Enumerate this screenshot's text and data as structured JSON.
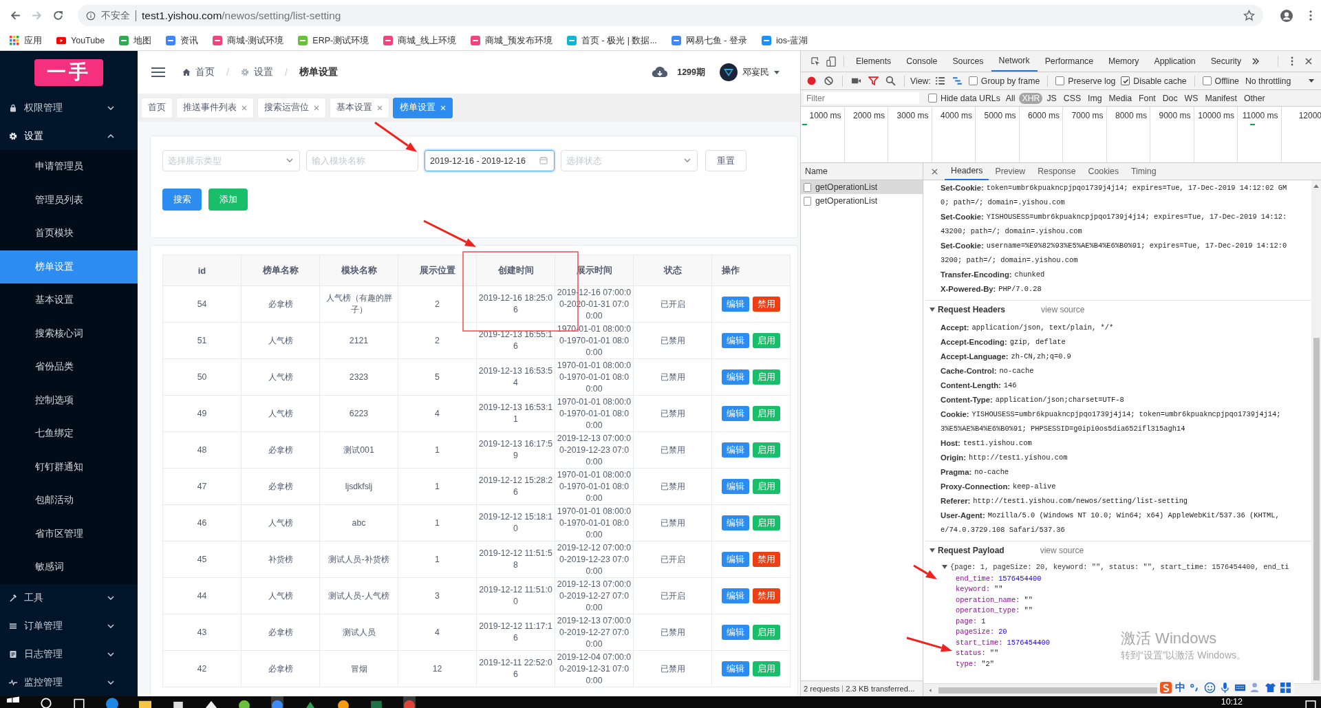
{
  "browser": {
    "security": "不安全",
    "url_host": "test1.yishou.com",
    "url_path": "/newos/setting/list-setting",
    "bookmarks": [
      {
        "label": "应用"
      },
      {
        "label": "YouTube"
      },
      {
        "label": "地图"
      },
      {
        "label": "资讯"
      },
      {
        "label": "商城-测试环境"
      },
      {
        "label": "ERP-测试环境"
      },
      {
        "label": "商城_线上环境"
      },
      {
        "label": "商城_预发布环境"
      },
      {
        "label": "首页 - 极光 | 数据..."
      },
      {
        "label": "网易七鱼 - 登录"
      },
      {
        "label": "ios-蓝湖"
      }
    ]
  },
  "sidebar": {
    "logo": "一手",
    "groups": [
      {
        "label": "权限管理",
        "expanded": false
      },
      {
        "label": "设置",
        "expanded": true,
        "children": [
          {
            "label": "申请管理员",
            "selected": false
          },
          {
            "label": "管理员列表",
            "selected": false
          },
          {
            "label": "首页模块",
            "selected": false
          },
          {
            "label": "榜单设置",
            "selected": true
          },
          {
            "label": "基本设置",
            "selected": false
          },
          {
            "label": "搜索核心词",
            "selected": false
          },
          {
            "label": "省份品类",
            "selected": false
          },
          {
            "label": "控制选项",
            "selected": false
          },
          {
            "label": "七鱼绑定",
            "selected": false
          },
          {
            "label": "钉钉群通知",
            "selected": false
          },
          {
            "label": "包邮活动",
            "selected": false
          },
          {
            "label": "省市区管理",
            "selected": false
          },
          {
            "label": "敏感词",
            "selected": false
          }
        ]
      },
      {
        "label": "工具",
        "expanded": false
      },
      {
        "label": "订单管理",
        "expanded": false
      },
      {
        "label": "日志管理",
        "expanded": false
      },
      {
        "label": "监控管理",
        "expanded": false
      }
    ]
  },
  "header": {
    "breadcrumb": [
      {
        "kind": "link",
        "label": "首页"
      },
      {
        "kind": "separator",
        "label": "/"
      },
      {
        "kind": "link",
        "label": "设置"
      },
      {
        "kind": "separator",
        "label": "/"
      },
      {
        "kind": "current",
        "label": "榜单设置"
      }
    ],
    "period": "1299期",
    "user": "邓宴民"
  },
  "tabs": [
    {
      "label": "首页",
      "closable": false,
      "selected": false
    },
    {
      "label": "推送事件列表",
      "closable": true,
      "selected": false
    },
    {
      "label": "搜索运营位",
      "closable": true,
      "selected": false
    },
    {
      "label": "基本设置",
      "closable": true,
      "selected": false
    },
    {
      "label": "榜单设置",
      "closable": true,
      "selected": true
    }
  ],
  "filters": {
    "type_placeholder": "选择展示类型",
    "name_placeholder": "输入模块名称",
    "date_value": "2019-12-16 - 2019-12-16",
    "date_focused": true,
    "status_placeholder": "选择状态",
    "reset": "重置",
    "search": "搜索",
    "add": "添加"
  },
  "table": {
    "columns": [
      "id",
      "榜单名称",
      "模块名称",
      "展示位置",
      "创建时间",
      "展示时间",
      "状态",
      "操作"
    ],
    "rows": [
      {
        "cells": [
          "54",
          "必拿榜",
          "人气榜（有趣的胖子）",
          "2",
          "2019-12-16 18:25:06",
          "2019-12-16 07:00:00-2020-01-31 07:00:00",
          "已开启"
        ],
        "actions": [
          {
            "label": "编辑",
            "kind": "edit"
          },
          {
            "label": "禁用",
            "kind": "disable"
          }
        ]
      },
      {
        "cells": [
          "51",
          "人气榜",
          "2121",
          "2",
          "2019-12-13 16:55:16",
          "1970-01-01 08:00:00-1970-01-01 08:00:00",
          "已禁用"
        ],
        "actions": [
          {
            "label": "编辑",
            "kind": "edit"
          },
          {
            "label": "启用",
            "kind": "enable"
          }
        ]
      },
      {
        "cells": [
          "50",
          "人气榜",
          "2323",
          "5",
          "2019-12-13 16:53:54",
          "1970-01-01 08:00:00-1970-01-01 08:00:00",
          "已禁用"
        ],
        "actions": [
          {
            "label": "编辑",
            "kind": "edit"
          },
          {
            "label": "启用",
            "kind": "enable"
          }
        ]
      },
      {
        "cells": [
          "49",
          "人气榜",
          "6223",
          "4",
          "2019-12-13 16:53:11",
          "1970-01-01 08:00:00-1970-01-01 08:00:00",
          "已禁用"
        ],
        "actions": [
          {
            "label": "编辑",
            "kind": "edit"
          },
          {
            "label": "启用",
            "kind": "enable"
          }
        ]
      },
      {
        "cells": [
          "48",
          "必拿榜",
          "测试001",
          "1",
          "2019-12-13 16:17:59",
          "2019-12-13 07:00:00-2019-12-23 07:00:00",
          "已禁用"
        ],
        "actions": [
          {
            "label": "编辑",
            "kind": "edit"
          },
          {
            "label": "启用",
            "kind": "enable"
          }
        ]
      },
      {
        "cells": [
          "47",
          "必拿榜",
          "ljsdkfslj",
          "1",
          "2019-12-12 15:28:26",
          "1970-01-01 08:00:00-1970-01-01 08:00:00",
          "已禁用"
        ],
        "actions": [
          {
            "label": "编辑",
            "kind": "edit"
          },
          {
            "label": "启用",
            "kind": "enable"
          }
        ]
      },
      {
        "cells": [
          "46",
          "人气榜",
          "abc",
          "1",
          "2019-12-12 15:18:10",
          "1970-01-01 08:00:00-1970-01-01 08:00:00",
          "已禁用"
        ],
        "actions": [
          {
            "label": "编辑",
            "kind": "edit"
          },
          {
            "label": "启用",
            "kind": "enable"
          }
        ]
      },
      {
        "cells": [
          "45",
          "补货榜",
          "测试人员-补货榜",
          "1",
          "2019-12-12 11:51:58",
          "2019-12-12 07:00:00-2019-12-23 07:00:00",
          "已开启"
        ],
        "actions": [
          {
            "label": "编辑",
            "kind": "edit"
          },
          {
            "label": "禁用",
            "kind": "disable"
          }
        ]
      },
      {
        "cells": [
          "44",
          "人气榜",
          "测试人员-人气榜",
          "3",
          "2019-12-12 11:51:00",
          "2019-12-13 07:00:00-2019-12-27 07:00:00",
          "已开启"
        ],
        "actions": [
          {
            "label": "编辑",
            "kind": "edit"
          },
          {
            "label": "禁用",
            "kind": "disable"
          }
        ]
      },
      {
        "cells": [
          "43",
          "必拿榜",
          "测试人员",
          "4",
          "2019-12-12 11:17:16",
          "2019-12-13 07:00:00-2019-12-27 07:00:00",
          "已禁用"
        ],
        "actions": [
          {
            "label": "编辑",
            "kind": "edit"
          },
          {
            "label": "启用",
            "kind": "enable"
          }
        ]
      },
      {
        "cells": [
          "42",
          "必拿榜",
          "冒烟",
          "12",
          "2019-12-11 22:52:06",
          "2019-12-04 07:00:00-2019-12-31 07:00:00",
          "已禁用"
        ],
        "actions": [
          {
            "label": "编辑",
            "kind": "edit"
          },
          {
            "label": "启用",
            "kind": "enable"
          }
        ]
      }
    ]
  },
  "devtools": {
    "panels": [
      {
        "label": "Elements",
        "selected": false
      },
      {
        "label": "Console",
        "selected": false
      },
      {
        "label": "Sources",
        "selected": false
      },
      {
        "label": "Network",
        "selected": true
      },
      {
        "label": "Performance",
        "selected": false
      },
      {
        "label": "Memory",
        "selected": false
      },
      {
        "label": "Application",
        "selected": false
      },
      {
        "label": "Security",
        "selected": false
      }
    ],
    "view_label": "View:",
    "options": [
      {
        "label": "Group by frame",
        "checked": false
      },
      {
        "label": "Preserve log",
        "checked": false
      },
      {
        "label": "Disable cache",
        "checked": true
      },
      {
        "label": "Offline",
        "checked": false
      }
    ],
    "throttling": "No throttling",
    "filter_placeholder": "Filter",
    "hide_data_urls": {
      "label": "Hide data URLs",
      "checked": false
    },
    "types": [
      {
        "label": "All",
        "selected": false
      },
      {
        "label": "XHR",
        "selected": true
      },
      {
        "label": "JS",
        "selected": false
      },
      {
        "label": "CSS",
        "selected": false
      },
      {
        "label": "Img",
        "selected": false
      },
      {
        "label": "Media",
        "selected": false
      },
      {
        "label": "Font",
        "selected": false
      },
      {
        "label": "Doc",
        "selected": false
      },
      {
        "label": "WS",
        "selected": false
      },
      {
        "label": "Manifest",
        "selected": false
      },
      {
        "label": "Other",
        "selected": false
      }
    ],
    "ticks": [
      "1000 ms",
      "2000 ms",
      "3000 ms",
      "4000 ms",
      "5000 ms",
      "6000 ms",
      "7000 ms",
      "8000 ms",
      "9000 ms",
      "10000 ms",
      "11000 ms",
      "12000"
    ],
    "name_header": "Name",
    "requests": [
      {
        "name": "getOperationList",
        "selected": true
      },
      {
        "name": "getOperationList",
        "selected": false
      }
    ],
    "summary": [
      "2 requests",
      "2.3 KB transferred..."
    ],
    "detail_tabs": [
      {
        "label": "Headers",
        "selected": true
      },
      {
        "label": "Preview",
        "selected": false
      },
      {
        "label": "Response",
        "selected": false
      },
      {
        "label": "Cookies",
        "selected": false
      },
      {
        "label": "Timing",
        "selected": false
      }
    ],
    "response_headers": [
      {
        "name": "Set-Cookie:",
        "lines": [
          "token=umbr6kpuakncpjpqo1739j4j14; expires=Tue, 17-Dec-2019 14:12:02 GM",
          "0; path=/; domain=.yishou.com"
        ]
      },
      {
        "name": "Set-Cookie:",
        "lines": [
          "YISHOUSESS=umbr6kpuakncpjpqo1739j4j14; expires=Tue, 17-Dec-2019 14:12:",
          "43200; path=/; domain=.yishou.com"
        ]
      },
      {
        "name": "Set-Cookie:",
        "lines": [
          "username=%E9%82%93%E5%AE%B4%E6%B0%91; expires=Tue, 17-Dec-2019 14:12:0",
          "3200; path=/; domain=.yishou.com"
        ]
      },
      {
        "name": "Transfer-Encoding:",
        "lines": [
          "chunked"
        ]
      },
      {
        "name": "X-Powered-By:",
        "lines": [
          "PHP/7.0.28"
        ]
      }
    ],
    "request_headers": {
      "title": "Request Headers",
      "view_source": "view source",
      "expanded": true,
      "items": [
        {
          "name": "Accept:",
          "lines": [
            "application/json, text/plain, */*"
          ]
        },
        {
          "name": "Accept-Encoding:",
          "lines": [
            "gzip, deflate"
          ]
        },
        {
          "name": "Accept-Language:",
          "lines": [
            "zh-CN,zh;q=0.9"
          ]
        },
        {
          "name": "Cache-Control:",
          "lines": [
            "no-cache"
          ]
        },
        {
          "name": "Content-Length:",
          "lines": [
            "146"
          ]
        },
        {
          "name": "Content-Type:",
          "lines": [
            "application/json;charset=UTF-8"
          ]
        },
        {
          "name": "Cookie:",
          "lines": [
            "YISHOUSESS=umbr6kpuakncpjpqo1739j4j14; token=umbr6kpuakncpjpqo1739j4j14;",
            "3%E5%AE%B4%E6%B0%91; PHPSESSID=g0ipi0os5dia652ifl315agh14"
          ]
        },
        {
          "name": "Host:",
          "lines": [
            "test1.yishou.com"
          ]
        },
        {
          "name": "Origin:",
          "lines": [
            "http://test1.yishou.com"
          ]
        },
        {
          "name": "Pragma:",
          "lines": [
            "no-cache"
          ]
        },
        {
          "name": "Proxy-Connection:",
          "lines": [
            "keep-alive"
          ]
        },
        {
          "name": "Referer:",
          "lines": [
            "http://test1.yishou.com/newos/setting/list-setting"
          ]
        },
        {
          "name": "User-Agent:",
          "lines": [
            "Mozilla/5.0 (Windows NT 10.0; Win64; x64) AppleWebKit/537.36 (KHTML,",
            "e/74.0.3729.108 Safari/537.36"
          ]
        }
      ]
    },
    "payload": {
      "title": "Request Payload",
      "view_source": "view source",
      "expanded": true,
      "summary": "{page: 1, pageSize: 20, keyword: \"\", status: \"\", start_time: 1576454400, end_ti",
      "properties": [
        {
          "key": "end_time:",
          "value": "1576454400",
          "kind": "number"
        },
        {
          "key": "keyword:",
          "value": "\"\"",
          "kind": "string"
        },
        {
          "key": "operation_name:",
          "value": "\"\"",
          "kind": "string"
        },
        {
          "key": "operation_type:",
          "value": "\"\"",
          "kind": "string"
        },
        {
          "key": "page:",
          "value": "1",
          "kind": "number"
        },
        {
          "key": "pageSize:",
          "value": "20",
          "kind": "number"
        },
        {
          "key": "start_time:",
          "value": "1576454400",
          "kind": "number"
        },
        {
          "key": "status:",
          "value": "\"\"",
          "kind": "string"
        },
        {
          "key": "type:",
          "value": "\"2\"",
          "kind": "string"
        }
      ]
    }
  },
  "os": {
    "activation_title": "激活 Windows",
    "activation_hint": "转到“设置”以激活 Windows。",
    "ime_mode": "中",
    "clock": "10:12"
  }
}
